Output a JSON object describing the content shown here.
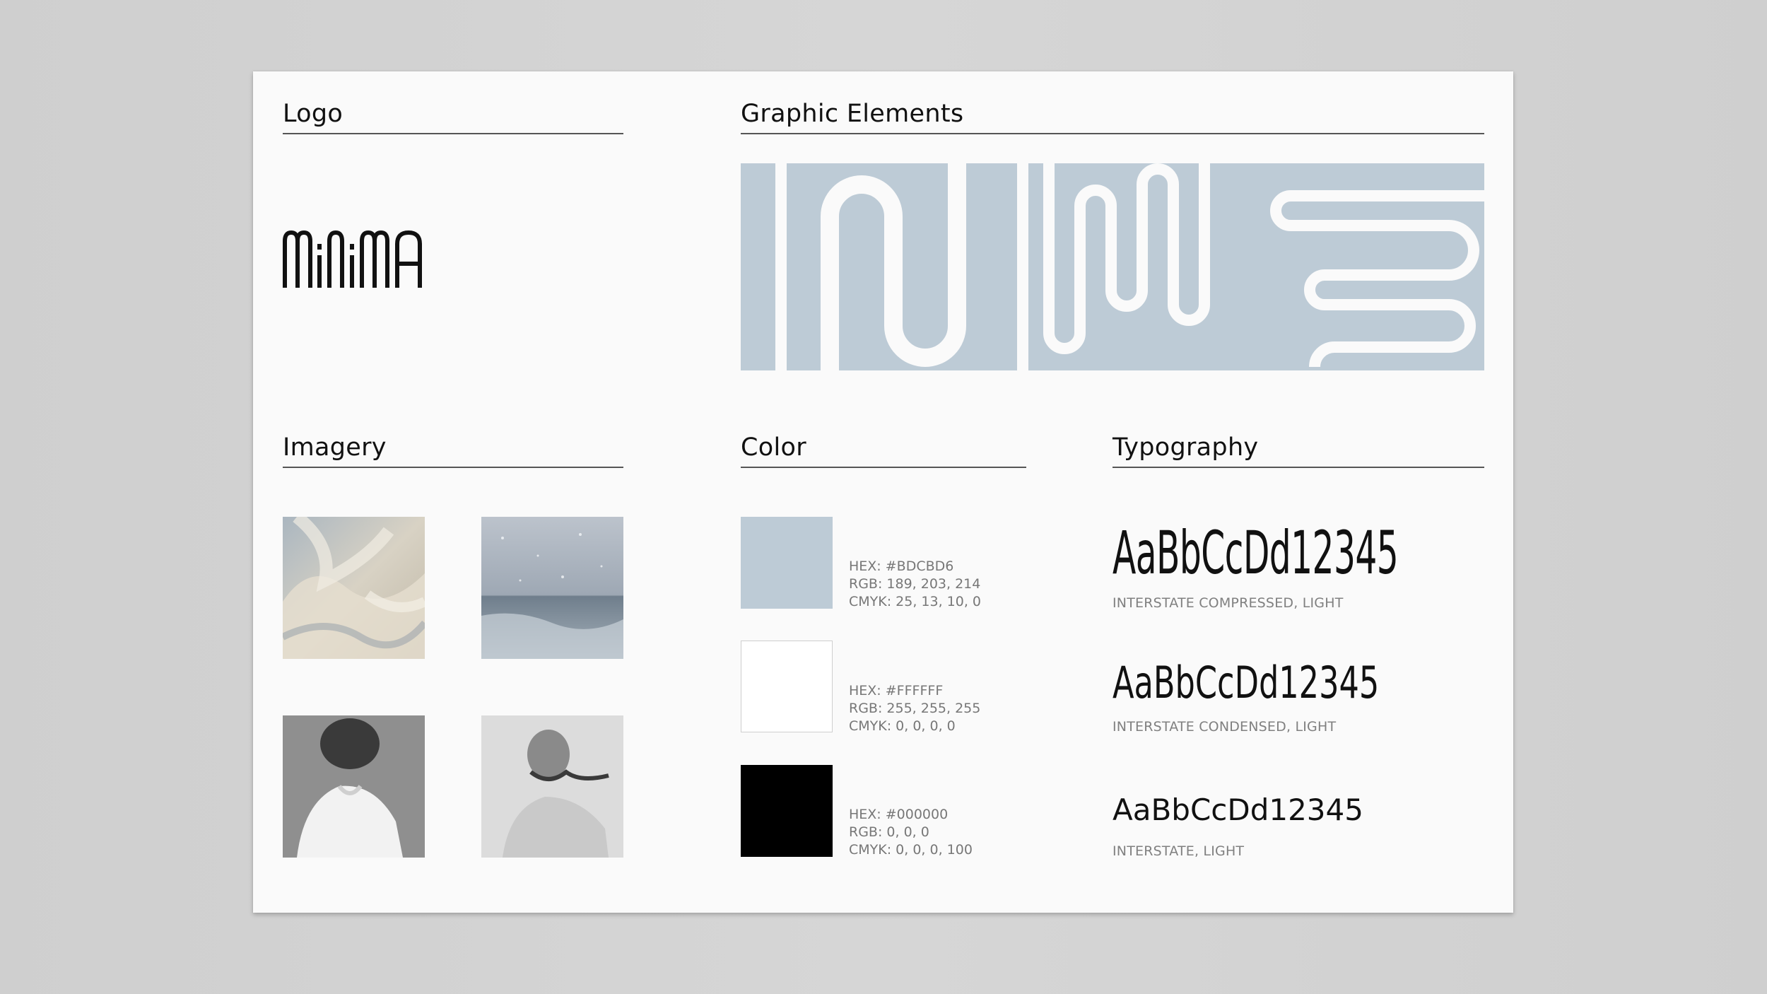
{
  "sections": {
    "logo": "Logo",
    "graphic": "Graphic Elements",
    "imagery": "Imagery",
    "color": "Color",
    "typography": "Typography"
  },
  "logo_text": "MiNiMA",
  "colors": [
    {
      "swatch": "#BDCBD6",
      "hex": "HEX: #BDCBD6",
      "rgb": "RGB: 189, 203, 214",
      "cmyk": "CMYK: 25, 13, 10, 0"
    },
    {
      "swatch": "#FFFFFF",
      "hex": "HEX: #FFFFFF",
      "rgb": "RGB: 255, 255, 255",
      "cmyk": "CMYK: 0, 0, 0, 0"
    },
    {
      "swatch": "#000000",
      "hex": "HEX: #000000",
      "rgb": "RGB: 0, 0, 0",
      "cmyk": "CMYK: 0, 0, 0, 100"
    }
  ],
  "typography": [
    {
      "sample": "AaBbCcDd12345",
      "name": "INTERSTATE COMPRESSED, LIGHT"
    },
    {
      "sample": "AaBbCcDd12345",
      "name": "INTERSTATE CONDENSED, LIGHT"
    },
    {
      "sample": "AaBbCcDd12345",
      "name": "INTERSTATE, LIGHT"
    }
  ],
  "accent": "#BDCBD6"
}
